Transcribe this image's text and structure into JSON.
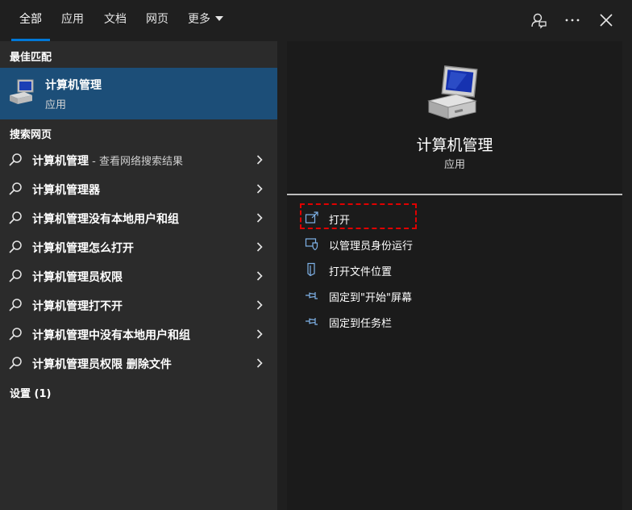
{
  "tabs": [
    {
      "label": "全部",
      "active": true
    },
    {
      "label": "应用",
      "active": false
    },
    {
      "label": "文档",
      "active": false
    },
    {
      "label": "网页",
      "active": false
    },
    {
      "label": "更多",
      "active": false,
      "dropdown": true
    }
  ],
  "top_icons": [
    "feedback-icon",
    "more-icon",
    "close-icon"
  ],
  "left": {
    "best_match_header": "最佳匹配",
    "best_match": {
      "title": "计算机管理",
      "subtitle": "应用",
      "icon": "computer-management-icon"
    },
    "web_header": "搜索网页",
    "web_items": [
      {
        "label": "计算机管理",
        "suffix": " - 查看网络搜索结果"
      },
      {
        "label": "计算机管理器",
        "suffix": ""
      },
      {
        "label": "计算机管理没有本地用户和组",
        "suffix": ""
      },
      {
        "label": "计算机管理怎么打开",
        "suffix": ""
      },
      {
        "label": "计算机管理员权限",
        "suffix": ""
      },
      {
        "label": "计算机管理打不开",
        "suffix": ""
      },
      {
        "label": "计算机管理中没有本地用户和组",
        "suffix": ""
      },
      {
        "label": "计算机管理员权限 删除文件",
        "suffix": ""
      }
    ],
    "settings_header": "设置 (1)"
  },
  "right": {
    "app_name": "计算机管理",
    "app_type": "应用",
    "actions": [
      {
        "label": "打开",
        "icon": "open-icon"
      },
      {
        "label": "以管理员身份运行",
        "icon": "run-as-admin-icon"
      },
      {
        "label": "打开文件位置",
        "icon": "file-location-icon"
      },
      {
        "label": "固定到\"开始\"屏幕",
        "icon": "pin-icon"
      },
      {
        "label": "固定到任务栏",
        "icon": "pin-icon"
      }
    ]
  },
  "colors": {
    "accent": "#0078d7",
    "selected": "#1c4e78",
    "highlight": "#e00000"
  }
}
